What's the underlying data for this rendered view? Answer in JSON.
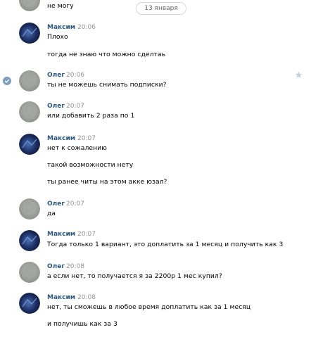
{
  "date_separator": "13 января",
  "colors": {
    "author": "#2a5885",
    "time": "#939393",
    "text": "#000000"
  },
  "icons": {
    "selected": "check-circle-icon",
    "favorite": "star-icon"
  },
  "messages": [
    {
      "lines": [
        "не могу"
      ]
    },
    {
      "author": "Максим",
      "time": "20:06",
      "lines": [
        "Плохо",
        "тогда не знаю что можно сделтаь"
      ]
    },
    {
      "author": "Олег",
      "time": "20:06",
      "lines": [
        "ты не можешь снимать подписки?"
      ]
    },
    {
      "author": "Олег",
      "time": "20:07",
      "lines": [
        "или добавить 2 раза по 1"
      ]
    },
    {
      "author": "Максим",
      "time": "20:07",
      "lines": [
        "нет к сожалению",
        "такой возможности нету",
        "ты ранее читы на этом акке юзал?"
      ]
    },
    {
      "author": "Олег",
      "time": "20:07",
      "lines": [
        "да"
      ]
    },
    {
      "author": "Максим",
      "time": "20:07",
      "lines": [
        "Тогда только 1 вариант, это доплатить за 1 месяц и получить как 3"
      ]
    },
    {
      "author": "Олег",
      "time": "20:08",
      "lines": [
        "а если нет, то получается я за 2200р 1 мес купил?"
      ]
    },
    {
      "author": "Максим",
      "time": "20:08",
      "lines": [
        "нет, ты сможешь в любое время доплатить как за 1 месяц",
        "и получишь как за 3"
      ]
    }
  ]
}
